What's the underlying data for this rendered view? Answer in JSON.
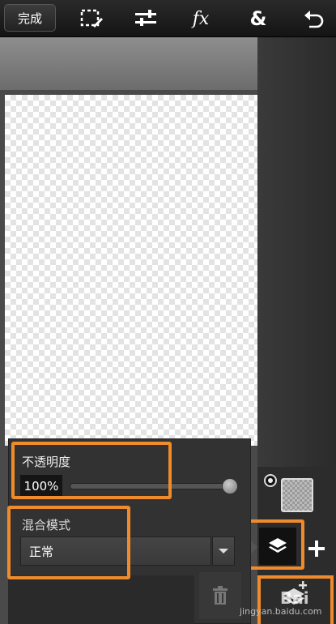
{
  "toolbar": {
    "done_label": "完成",
    "icons": [
      "selection-edit-icon",
      "adjust-icon",
      "fx-icon",
      "ampersand-icon",
      "undo-icon"
    ],
    "fx_glyph": "fx",
    "amp_glyph": "&"
  },
  "properties": {
    "opacity_label": "不透明度",
    "opacity_value": "100%",
    "opacity_fraction": 1.0,
    "blend_label": "混合模式",
    "blend_value": "正常"
  },
  "watermark": {
    "text": "jingyan.baidu.com",
    "logo": "Bai"
  },
  "colors": {
    "highlight": "#f08b2c",
    "toolbar_bg": "#1c1c1c",
    "panel_bg": "#323232"
  }
}
